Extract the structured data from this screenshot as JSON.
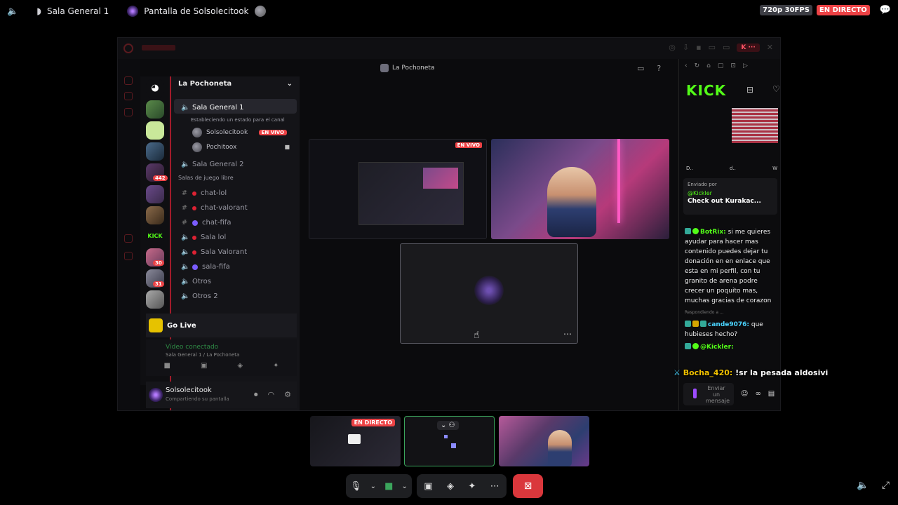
{
  "topbar": {
    "channel": "Sala General 1",
    "screen_title": "Pantalla de Solsolecitook",
    "quality": "720p 30FPS",
    "live": "EN DIRECTO"
  },
  "stream": {
    "call_title": "La Pochoneta",
    "server_name": "La Pochoneta",
    "channels": [
      {
        "name": "Sala General 1",
        "status": "Estableciendo un estado para el canal"
      },
      {
        "name": "Sala General 2"
      }
    ],
    "members": [
      {
        "name": "Solsolecitook",
        "badge": "EN VIVO"
      },
      {
        "name": "Pochitoox"
      }
    ],
    "category": "Salas de juego libre",
    "text_channels": [
      "chat-lol",
      "chat-valorant",
      "chat-fifa"
    ],
    "voice_channels": [
      "Sala lol",
      "Sala Valorant",
      "sala-fifa",
      "Otros",
      "Otros 2"
    ],
    "badges": {
      "b1": "442",
      "b2": "30",
      "b3": "31"
    },
    "go_live": "Go Live",
    "voice_connected": "Vídeo conectado",
    "voice_location": "Sala General 1 / La Pochoneta",
    "user_name": "Solsolecitook",
    "user_status": "Compartiendo su pantalla",
    "tile_live": "EN VIVO",
    "kick": {
      "logo": "KICK",
      "tabs": [
        "D..",
        "d..",
        "W"
      ],
      "pinned_label": "Enviado por",
      "pinned_user": "@Kickler",
      "pinned_text": "Check out Kurakac...",
      "messages": [
        {
          "user": "BotRix:",
          "text": "si me quieres ayudar para hacer mas contenido puedes dejar tu donación en en enlace que esta en mi perfil, con tu granito de arena podre crecer un poquito mas, muchas gracias de corazon"
        },
        {
          "user": "cande9076:",
          "text": "que hubieses hecho?"
        },
        {
          "user": "@Kickler:",
          "text": ""
        }
      ],
      "reply_label": "Respondiendo a ...",
      "input_placeholder": "Enviar un mensaje"
    }
  },
  "overlay": {
    "user": "Bocha_420:",
    "text": "!sr la pesada aldosivi"
  },
  "thumbnails": {
    "live_badge": "EN DIRECTO"
  },
  "colors": {
    "live_red": "#ed4245",
    "kick_green": "#53fc18",
    "discord_green": "#3ba55c",
    "end_call_red": "#da373c"
  }
}
